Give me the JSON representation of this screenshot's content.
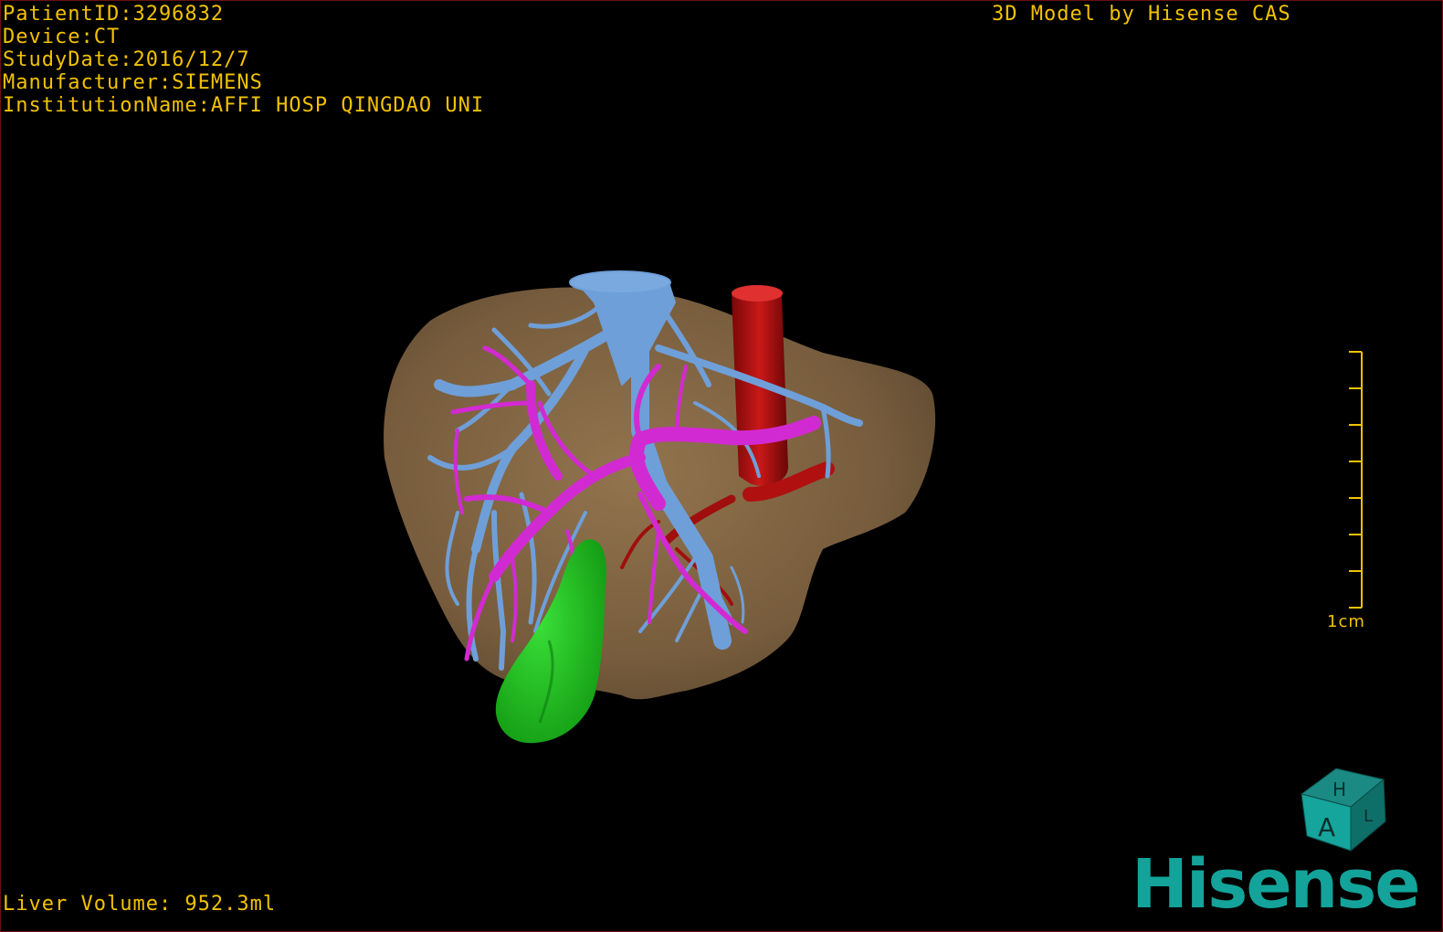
{
  "overlay": {
    "patient_id": "PatientID:3296832",
    "device": "Device:CT",
    "study_date": "StudyDate:2016/12/7",
    "manufacturer": "Manufacturer:SIEMENS",
    "institution": "InstitutionName:AFFI HOSP QINGDAO UNI",
    "credit": "3D Model by Hisense CAS",
    "liver_volume": "Liver Volume: 952.3ml"
  },
  "scale_bar": {
    "label": "1cm"
  },
  "orientation_cube": {
    "top_letter": "H",
    "front_letter": "A",
    "side_letter": "L"
  },
  "brand": {
    "name": "Hisense",
    "color": "#14a39a"
  },
  "colors": {
    "text": "#f2c200",
    "liver": "#8a6a45",
    "hepatic_vein": "#6f9fd8",
    "portal_vein": "#d22ad2",
    "artery": "#b01010",
    "gallbladder": "#22c21f",
    "border": "#6b1010"
  },
  "model_structures": [
    "liver-surface",
    "hepatic-vein",
    "portal-vein",
    "artery",
    "gallbladder"
  ]
}
